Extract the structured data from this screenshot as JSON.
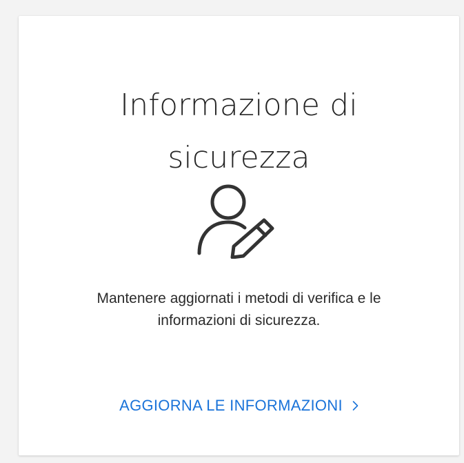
{
  "card": {
    "title_lines": [
      "Informazione di",
      "sicurezza"
    ],
    "icon": "user-edit-icon",
    "description_lines": [
      "Mantenere aggiornati i metodi di verifica e le",
      "informazioni di sicurezza."
    ],
    "action_label": "AGGIORNA LE INFORMAZIONI",
    "action_icon": "chevron-right-icon"
  },
  "colors": {
    "link": "#1a73d9",
    "title_text": "#262626",
    "body_text": "#2b2b2b",
    "card_bg": "#ffffff",
    "page_bg": "#f3f3f3"
  }
}
